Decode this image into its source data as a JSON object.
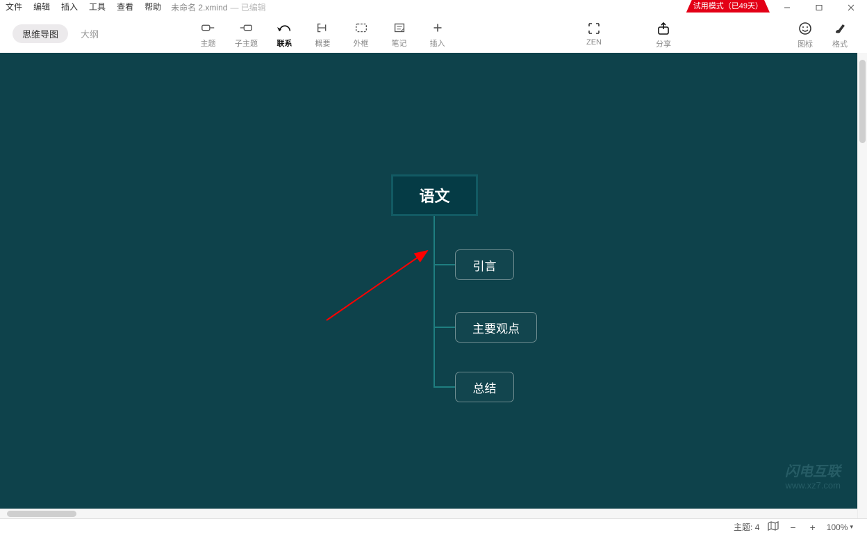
{
  "menu": {
    "file": "文件",
    "edit": "编辑",
    "insert": "插入",
    "tools": "工具",
    "view": "查看",
    "help": "帮助"
  },
  "title": {
    "filename": "未命名 2.xmind",
    "status": "— 已编辑"
  },
  "trial": {
    "text": "试用模式（已49天）"
  },
  "view_toggle": {
    "mindmap": "思维导图",
    "outline": "大纲"
  },
  "toolbar": {
    "topic": "主题",
    "subtopic": "子主题",
    "relationship": "联系",
    "summary": "概要",
    "boundary": "外框",
    "note": "笔记",
    "insert": "插入",
    "zen": "ZEN",
    "share": "分享",
    "icons": "图标",
    "format": "格式"
  },
  "mindmap": {
    "root": "语文",
    "children": [
      "引言",
      "主要观点",
      "总结"
    ]
  },
  "status": {
    "topics_label": "主题:",
    "topics_count": "4",
    "zoom": "100%"
  },
  "watermark": {
    "line1": "闪电互联",
    "line2": "www.xz7.com"
  }
}
